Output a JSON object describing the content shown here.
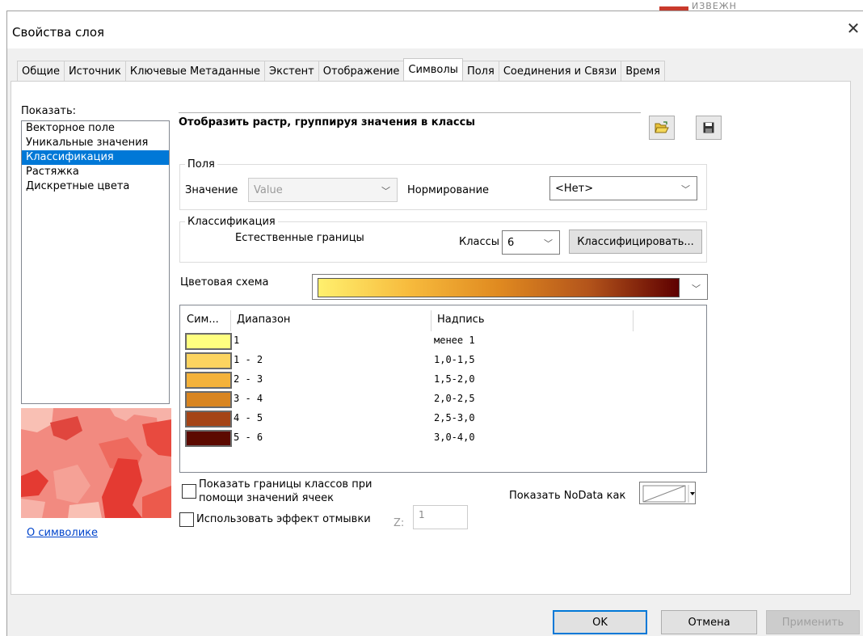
{
  "window": {
    "title": "Свойства слоя",
    "close_glyph": "✕",
    "background_partial_text": "ИЗВЕЖН"
  },
  "tabs": [
    {
      "label": "Общие"
    },
    {
      "label": "Источник"
    },
    {
      "label": "Ключевые Метаданные"
    },
    {
      "label": "Экстент"
    },
    {
      "label": "Отображение"
    },
    {
      "label": "Символы",
      "active": true
    },
    {
      "label": "Поля"
    },
    {
      "label": "Соединения и Связи"
    },
    {
      "label": "Время"
    }
  ],
  "show_panel": {
    "label": "Показать:",
    "items": [
      "Векторное поле",
      "Уникальные значения",
      "Классификация",
      "Растяжка",
      "Дискретные цвета"
    ],
    "selected_index": 2
  },
  "about_link": "О символике",
  "header": {
    "title": "Отобразить растр, группируя значения в классы",
    "open_icon": "folder-open-icon",
    "save_icon": "save-icon"
  },
  "fields_group": {
    "legend": "Поля",
    "value_label": "Значение",
    "value_selected": "Value",
    "normalization_label": "Нормирование",
    "normalization_selected": "<Нет>"
  },
  "classification_group": {
    "legend": "Классификация",
    "method": "Естественные границы",
    "classes_label": "Классы",
    "classes_value": "6",
    "classify_button": "Классифицировать..."
  },
  "color_scheme": {
    "label": "Цветовая схема",
    "ramp_colors": [
      "#fff06e",
      "#f7bb3d",
      "#e08a20",
      "#b3541b",
      "#5e0000"
    ]
  },
  "classes_table": {
    "columns": [
      "Сим...",
      "Диапазон",
      "Надпись"
    ],
    "rows": [
      {
        "color": "#ffff80",
        "range": "1",
        "label": "менее 1"
      },
      {
        "color": "#fcd460",
        "range": "1 - 2",
        "label": "1,0-1,5"
      },
      {
        "color": "#f4b23a",
        "range": "2 - 3",
        "label": "1,5-2,0"
      },
      {
        "color": "#d98520",
        "range": "3 - 4",
        "label": "2,0-2,5"
      },
      {
        "color": "#a54416",
        "range": "4 - 5",
        "label": "2,5-3,0"
      },
      {
        "color": "#5c0a00",
        "range": "5 - 6",
        "label": "3,0-4,0"
      }
    ]
  },
  "options": {
    "show_class_breaks_label": "Показать границы классов при помощи значений ячеек",
    "show_class_breaks_line1": "Показать границы классов при",
    "show_class_breaks_line2": "помощи значений ячеек",
    "hillshade_label": "Использовать эффект отмывки",
    "z_label": "Z:",
    "z_value": "1",
    "nodata_label": "Показать NoData как"
  },
  "buttons": {
    "ok": "OK",
    "cancel": "Отмена",
    "apply": "Применить"
  }
}
